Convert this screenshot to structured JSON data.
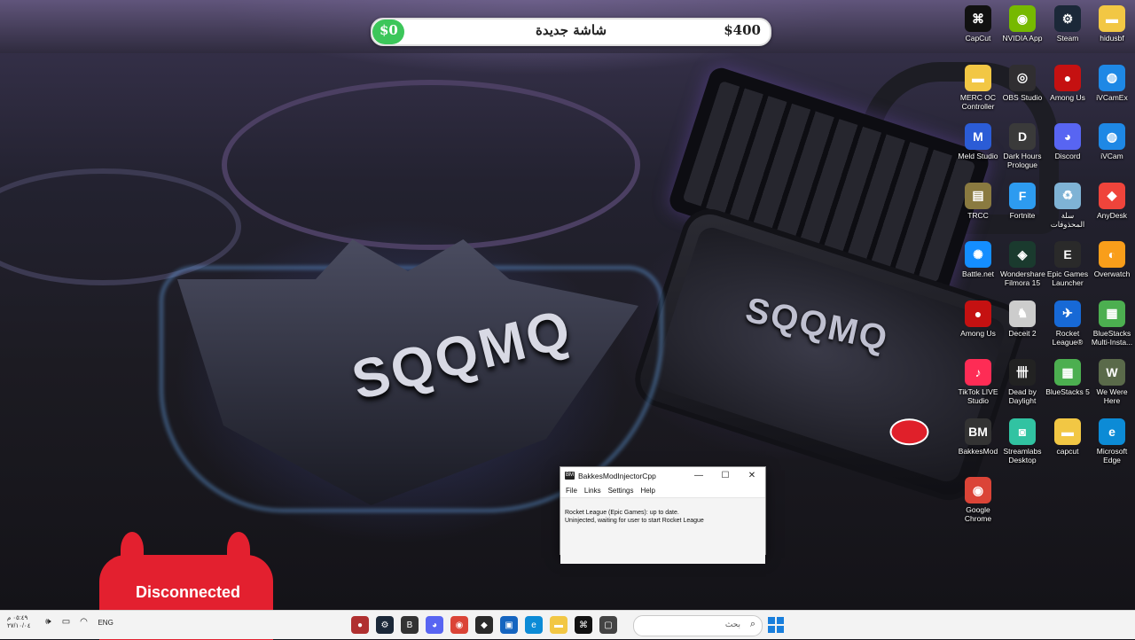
{
  "topbar": {
    "left_amount": "$0",
    "title": "شاشة جديدة",
    "right_amount": "$400",
    "progress": 0.04
  },
  "desktop_icons": [
    {
      "label": "CapCut",
      "icon": "capcut-icon",
      "glyph": "⌘",
      "color": "#111111"
    },
    {
      "label": "NVIDIA App",
      "icon": "nvidia-icon",
      "glyph": "◉",
      "color": "#76b900"
    },
    {
      "label": "Steam",
      "icon": "steam-icon",
      "glyph": "⚙",
      "color": "#1b2838"
    },
    {
      "label": "hidusbf",
      "icon": "folder-icon",
      "glyph": "▬",
      "color": "#f2c744"
    },
    {
      "label": "MERC OC Controller",
      "icon": "folder-icon",
      "glyph": "▬",
      "color": "#f2c744"
    },
    {
      "label": "OBS Studio",
      "icon": "obs-icon",
      "glyph": "◎",
      "color": "#302e31"
    },
    {
      "label": "Among Us",
      "icon": "among-us-icon",
      "glyph": "●",
      "color": "#c51111"
    },
    {
      "label": "iVCamEx",
      "icon": "ivcam-icon",
      "glyph": "◍",
      "color": "#1e88e5"
    },
    {
      "label": "Meld Studio",
      "icon": "meld-icon",
      "glyph": "M",
      "color": "#2b5cd6"
    },
    {
      "label": "Dark Hours Prologue",
      "icon": "dark-hours-icon",
      "glyph": "D",
      "color": "#3a3a3a"
    },
    {
      "label": "Discord",
      "icon": "discord-icon",
      "glyph": "◕",
      "color": "#5865f2"
    },
    {
      "label": "iVCam",
      "icon": "ivcam-icon",
      "glyph": "◍",
      "color": "#1e88e5"
    },
    {
      "label": "TRCC",
      "icon": "trcc-icon",
      "glyph": "▤",
      "color": "#8a7a40"
    },
    {
      "label": "Fortnite",
      "icon": "fortnite-icon",
      "glyph": "F",
      "color": "#2d9bf0"
    },
    {
      "label": "سلة المحذوفات",
      "icon": "recycle-bin-icon",
      "glyph": "♻",
      "color": "#7fb3d5"
    },
    {
      "label": "AnyDesk",
      "icon": "anydesk-icon",
      "glyph": "◆",
      "color": "#ef443b"
    },
    {
      "label": "Battle.net",
      "icon": "battlenet-icon",
      "glyph": "✺",
      "color": "#148eff"
    },
    {
      "label": "Wondershare Filmora 15",
      "icon": "filmora-icon",
      "glyph": "◈",
      "color": "#1a3a2e"
    },
    {
      "label": "Epic Games Launcher",
      "icon": "epic-games-icon",
      "glyph": "E",
      "color": "#2a2a2a"
    },
    {
      "label": "Overwatch",
      "icon": "overwatch-icon",
      "glyph": "◐",
      "color": "#f99e1a"
    },
    {
      "label": "Among Us",
      "icon": "among-us-icon",
      "glyph": "●",
      "color": "#c51111"
    },
    {
      "label": "Deceit 2",
      "icon": "deceit-icon",
      "glyph": "♞",
      "color": "#cccccc"
    },
    {
      "label": "Rocket League®",
      "icon": "rocket-league-icon",
      "glyph": "✈",
      "color": "#1769d6"
    },
    {
      "label": "BlueStacks Multi-Insta...",
      "icon": "bluestacks-icon",
      "glyph": "▦",
      "color": "#4caf50"
    },
    {
      "label": "TikTok LIVE Studio",
      "icon": "tiktok-icon",
      "glyph": "♪",
      "color": "#fe2c55"
    },
    {
      "label": "Dead by Daylight",
      "icon": "dbd-icon",
      "glyph": "卌",
      "color": "#222222"
    },
    {
      "label": "BlueStacks 5",
      "icon": "bluestacks-icon",
      "glyph": "▦",
      "color": "#4caf50"
    },
    {
      "label": "We Were Here",
      "icon": "we-were-here-icon",
      "glyph": "W",
      "color": "#5a6a4a"
    },
    {
      "label": "BakkesMod",
      "icon": "bakkesmod-icon",
      "glyph": "BM",
      "color": "#333333"
    },
    {
      "label": "Streamlabs Desktop",
      "icon": "streamlabs-icon",
      "glyph": "◙",
      "color": "#31c3a2"
    },
    {
      "label": "capcut",
      "icon": "folder-icon",
      "glyph": "▬",
      "color": "#f2c744"
    },
    {
      "label": "Microsoft Edge",
      "icon": "edge-icon",
      "glyph": "e",
      "color": "#0c8bd6"
    },
    {
      "label": "Google Chrome",
      "icon": "chrome-icon",
      "glyph": "◉",
      "color": "#db4437"
    }
  ],
  "controller_badge": {
    "label": "Disconnected"
  },
  "window": {
    "title": "BakkesModInjectorCpp",
    "app_icon": "BM",
    "minimize": "—",
    "maximize": "☐",
    "close": "✕",
    "menu": [
      "File",
      "Links",
      "Settings",
      "Help"
    ],
    "lines": [
      "Rocket League (Epic Games): up to date.",
      "Uninjected, waiting for user to start Rocket League"
    ]
  },
  "taskbar": {
    "time": "٠٥:٤٩ م",
    "date": "٢٧/١٠/٠٤",
    "language": "ENG",
    "search_placeholder": "بحث",
    "apps": [
      {
        "icon": "red-app-icon",
        "color": "#b03030",
        "glyph": "●"
      },
      {
        "icon": "steam-icon",
        "color": "#1b2838",
        "glyph": "⚙"
      },
      {
        "icon": "bakkesmod-icon",
        "color": "#333333",
        "glyph": "B"
      },
      {
        "icon": "discord-icon",
        "color": "#5865f2",
        "glyph": "◕"
      },
      {
        "icon": "chrome-icon",
        "color": "#db4437",
        "glyph": "◉"
      },
      {
        "icon": "epic-games-icon",
        "color": "#2a2a2a",
        "glyph": "◆"
      },
      {
        "icon": "store-icon",
        "color": "#1565c0",
        "glyph": "▣"
      },
      {
        "icon": "edge-icon",
        "color": "#0c8bd6",
        "glyph": "e"
      },
      {
        "icon": "file-explorer-icon",
        "color": "#f2c744",
        "glyph": "▬"
      },
      {
        "icon": "capcut-icon",
        "color": "#111111",
        "glyph": "⌘"
      },
      {
        "icon": "task-view-icon",
        "color": "#444444",
        "glyph": "▢"
      }
    ]
  }
}
